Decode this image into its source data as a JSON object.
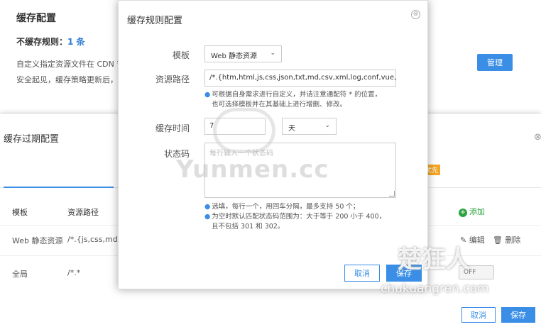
{
  "background": {
    "title": "缓存配置",
    "nocache_label": "不缓存规则：",
    "nocache_count": "1 条",
    "desc1": "自定义指定资源文件在 CDN 节",
    "desc2": "安全起见，缓存策略更新后，",
    "manage_button": "管理",
    "drawer_title": "缓存过期配置",
    "drawer_close": "⊗",
    "badge": "优先",
    "table": {
      "col_template": "模板",
      "col_path": "资源路径",
      "add_label": "添加",
      "rows": [
        {
          "template": "Web 静态资源",
          "path": "/*.{js,css,md,cs",
          "edit": "编辑",
          "delete": "删除"
        },
        {
          "template": "全局",
          "path": "/*.*",
          "toggle": "OFF"
        }
      ]
    },
    "cancel_button": "取消",
    "save_button": "保存"
  },
  "modal": {
    "title": "缓存规则配置",
    "close_icon": "⊗",
    "template_label": "模板",
    "template_value": "Web 静态资源",
    "path_label": "资源路径",
    "path_value": "/*.{htm,html,js,css,json,txt,md,csv,xml,log,conf,vue,jpg",
    "path_hint1": "可根据自身需求进行自定义，并请注意通配符 * 的位置，",
    "path_hint2": "也可选择模板并在其基础上进行增删、修改。",
    "time_label": "缓存时间",
    "time_value": "7",
    "time_unit": "天",
    "status_label": "状态码",
    "status_placeholder": "每行输入一个状态码",
    "status_hint1": "选填，每行一个，用回车分隔，最多支持 50 个；",
    "status_hint2": "为空时默认匹配状态码范围为：大于等于 200 小于 400，",
    "status_hint3": "且不包括 301 和 302。",
    "cancel_button": "取消",
    "save_button": "保存"
  },
  "watermarks": {
    "yunmen": "Yunmen.cc",
    "chukuang": "楚狂人",
    "site": "chukuangren.com"
  },
  "colors": {
    "accent": "#3a8ee6",
    "add_green": "#2aa33e",
    "badge": "#f5a623"
  }
}
